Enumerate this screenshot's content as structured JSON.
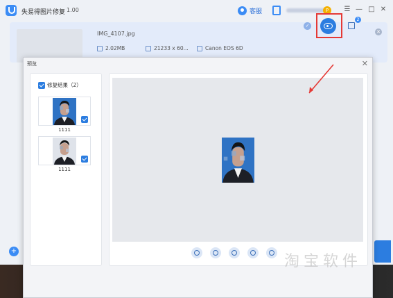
{
  "app": {
    "title": "失易得图片修复",
    "version": "1.00",
    "service_label": "客服",
    "vip_badge": "P"
  },
  "window_controls": {
    "menu": "☰",
    "minimize": "—",
    "maximize": "□",
    "close": "✕"
  },
  "file": {
    "name": "IMG_4107.jpg",
    "size": "2.02MB",
    "resolution": "21233 x 60...",
    "camera": "Canon EOS 6D",
    "check": "✓",
    "save_count": "2",
    "remove": "✕"
  },
  "main": {
    "add_icon": "+"
  },
  "dialog": {
    "title": "预览",
    "close": "✕",
    "select_all_label": "修复结果（2）",
    "items": [
      {
        "label": "1111"
      },
      {
        "label": "1111"
      }
    ]
  },
  "watermark": "淘宝软件"
}
